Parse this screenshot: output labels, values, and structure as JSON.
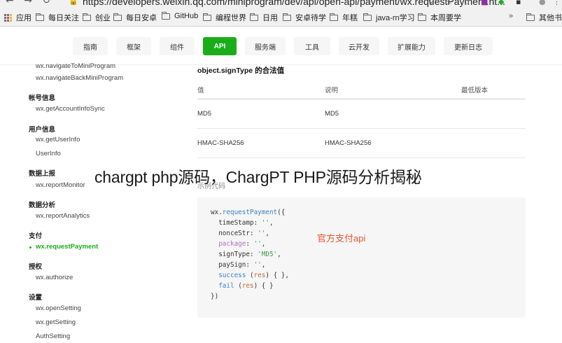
{
  "browser": {
    "url": "https://developers.weixin.qq.com/miniprogram/dev/api/open-api/payment/wx.requestPayment.ht..."
  },
  "bookmarks": {
    "apps_label": "应用",
    "items": [
      "每日关注",
      "创业",
      "每日安卓",
      "GitHub",
      "编程世界",
      "日用",
      "安卓待学",
      "年糕",
      "java-rn学习",
      "本周要学"
    ],
    "overflow": "»",
    "other": "其他书签"
  },
  "topnav": {
    "tabs": [
      "指南",
      "框架",
      "组件",
      "API",
      "服务端",
      "工具",
      "云开发",
      "扩展能力",
      "更新日志"
    ],
    "active": "API"
  },
  "sidebar": {
    "cut_item": "wx.navigateToMiniProgram",
    "item_navigate_back": "wx.navigateBackMiniProgram",
    "group_account": "帐号信息",
    "item_account": "wx.getAccountInfoSync",
    "group_userinfo": "用户信息",
    "item_getuserinfo": "wx.getUserInfo",
    "item_userinfo": "UserInfo",
    "group_report": "数据上报",
    "item_report_monitor": "wx.reportMonitor",
    "group_analysis": "数据分析",
    "item_report_analytics": "wx.reportAnalytics",
    "group_pay": "支付",
    "item_request_payment": "wx.requestPayment",
    "group_auth": "授权",
    "item_authorize": "wx.authorize",
    "group_settings": "设置",
    "item_open_setting": "wx.openSetting",
    "item_get_setting": "wx.getSetting",
    "item_auth_setting": "AuthSetting"
  },
  "main": {
    "subtitle": "object.signType 的合法值",
    "table": {
      "headers": [
        "值",
        "说明",
        "最低版本"
      ],
      "rows": [
        [
          "MD5",
          "MD5",
          ""
        ],
        [
          "HMAC-SHA256",
          "HMAC-SHA256",
          ""
        ]
      ]
    },
    "example_label": "示例代码",
    "code": {
      "l1_obj": "wx.",
      "l1_fn": "requestPayment",
      "l1_rest": "({",
      "l2_key": "  timeStamp: ",
      "l2_val": "''",
      "l2_end": ",",
      "l3_key": "  nonceStr: ",
      "l3_val": "''",
      "l3_end": ",",
      "l4_key": "  package",
      "l4_sep": ": ",
      "l4_val": "''",
      "l4_end": ",",
      "l5_key": "  signType: ",
      "l5_val": "'MD5'",
      "l5_end": ",",
      "l6_key": "  paySign: ",
      "l6_val": "''",
      "l6_end": ",",
      "l7_key": "  success",
      "l7_sp": " (",
      "l7_arg": "res",
      "l7_end": ") { },",
      "l8_key": "  fail",
      "l8_sp": " (",
      "l8_arg": "res",
      "l8_end": ") { }",
      "l9": "})"
    },
    "annotation": "官方支付api"
  },
  "overlay_caption": "chargpt php源码，ChargPT PHP源码分析揭秘",
  "colors": {
    "accent_green": "#1aad19",
    "annotation_red": "#e8542a"
  }
}
